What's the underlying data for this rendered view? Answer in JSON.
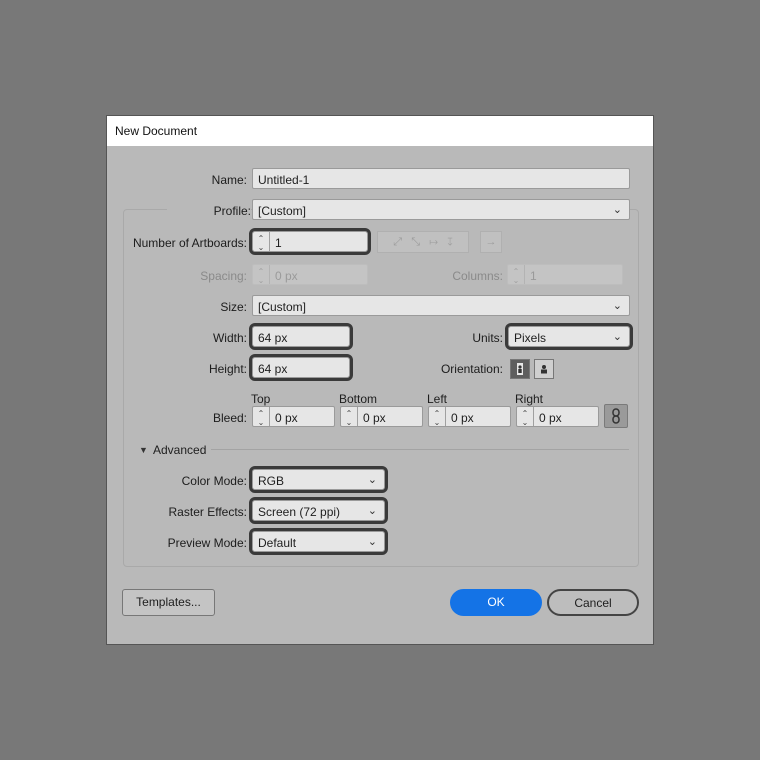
{
  "dialog": {
    "title": "New Document"
  },
  "fields": {
    "name": {
      "label": "Name:",
      "value": "Untitled-1"
    },
    "profile": {
      "label": "Profile:",
      "value": "[Custom]"
    },
    "artboards": {
      "label": "Number of Artboards:",
      "value": "1"
    },
    "spacing": {
      "label": "Spacing:",
      "value": "0 px"
    },
    "columns": {
      "label": "Columns:",
      "value": "1"
    },
    "size": {
      "label": "Size:",
      "value": "[Custom]"
    },
    "width": {
      "label": "Width:",
      "value": "64 px"
    },
    "units": {
      "label": "Units:",
      "value": "Pixels"
    },
    "height": {
      "label": "Height:",
      "value": "64 px"
    },
    "orientation": {
      "label": "Orientation:"
    },
    "bleed": {
      "label": "Bleed:",
      "top": {
        "label": "Top",
        "value": "0 px"
      },
      "bottom": {
        "label": "Bottom",
        "value": "0 px"
      },
      "left": {
        "label": "Left",
        "value": "0 px"
      },
      "right": {
        "label": "Right",
        "value": "0 px"
      }
    },
    "advanced": {
      "label": "Advanced"
    },
    "color_mode": {
      "label": "Color Mode:",
      "value": "RGB"
    },
    "raster_effects": {
      "label": "Raster Effects:",
      "value": "Screen (72 ppi)"
    },
    "preview_mode": {
      "label": "Preview Mode:",
      "value": "Default"
    }
  },
  "buttons": {
    "templates": "Templates...",
    "ok": "OK",
    "cancel": "Cancel"
  },
  "colors": {
    "ok_button": "#1473e6",
    "highlight_outline": "#3a3a3a",
    "background": "#787878"
  }
}
